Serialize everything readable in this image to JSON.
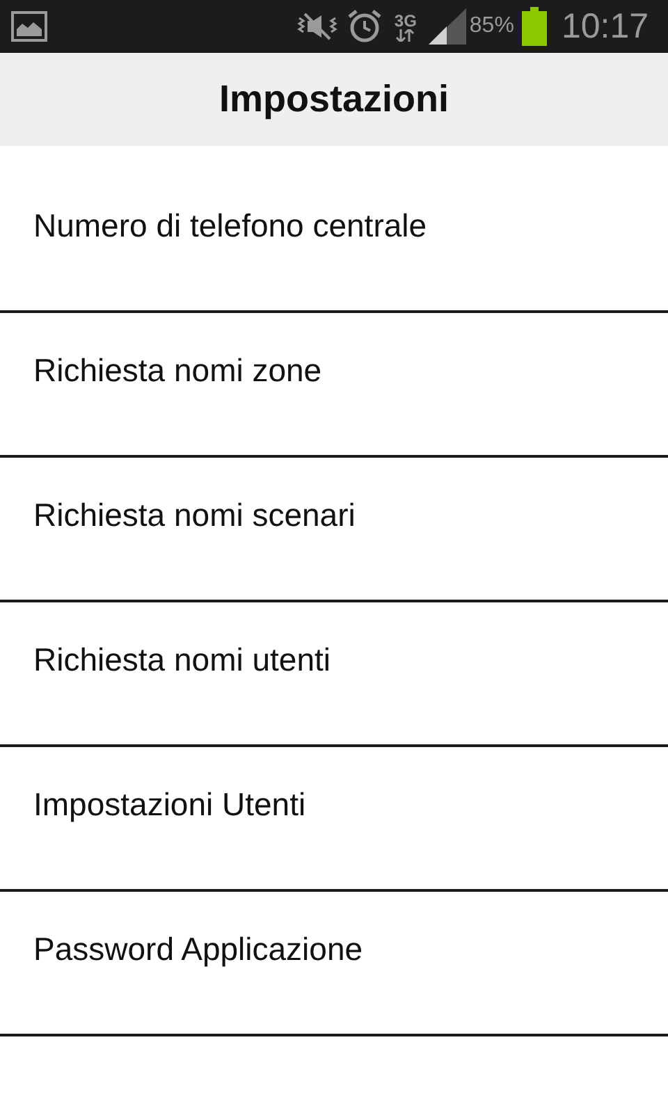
{
  "status_bar": {
    "network": "3G",
    "battery": "85%",
    "time": "10:17"
  },
  "header": {
    "title": "Impostazioni"
  },
  "items": [
    {
      "label": "Numero di telefono centrale"
    },
    {
      "label": "Richiesta nomi zone"
    },
    {
      "label": "Richiesta nomi scenari"
    },
    {
      "label": "Richiesta nomi utenti"
    },
    {
      "label": "Impostazioni Utenti"
    },
    {
      "label": "Password Applicazione"
    }
  ]
}
